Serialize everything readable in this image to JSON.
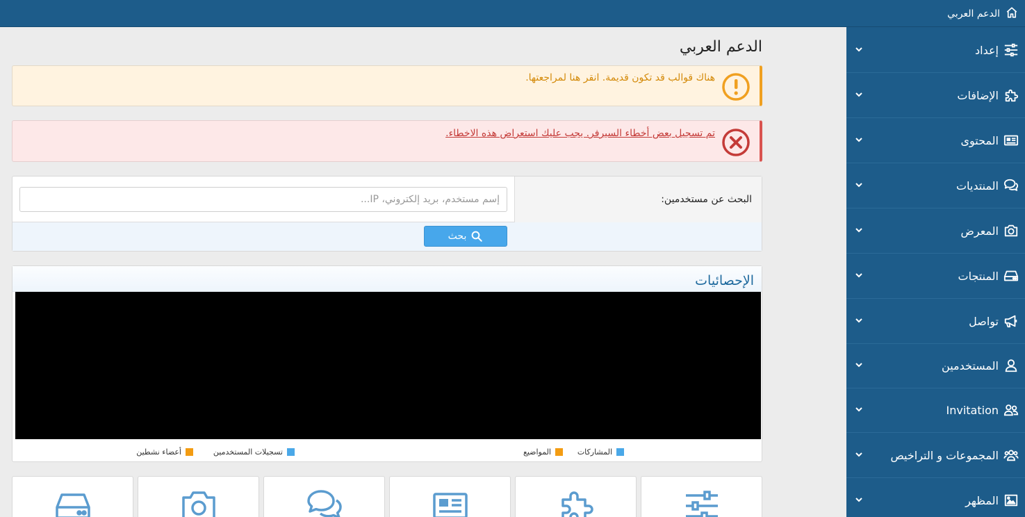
{
  "topbar": {
    "home_label": "الدعم العربي",
    "icon": "home-icon"
  },
  "sidebar": {
    "items": [
      {
        "label": "إعداد",
        "icon": "sliders-icon"
      },
      {
        "label": "الإضافات",
        "icon": "puzzle-icon"
      },
      {
        "label": "المحتوى",
        "icon": "newspaper-icon"
      },
      {
        "label": "المنتديات",
        "icon": "comments-icon"
      },
      {
        "label": "المعرض",
        "icon": "camera-icon"
      },
      {
        "label": "المنتجات",
        "icon": "hdd-icon"
      },
      {
        "label": "تواصل",
        "icon": "megaphone-icon"
      },
      {
        "label": "المستخدمين",
        "icon": "user-icon"
      },
      {
        "label": "Invitation",
        "icon": "user-friends-icon"
      },
      {
        "label": "المجموعات و التراخيص",
        "icon": "users-icon"
      },
      {
        "label": "المظهر",
        "icon": "image-icon"
      }
    ]
  },
  "main": {
    "title": "الدعم العربي",
    "warning": "هناك قوالب قد تكون قديمة. انقر هنا لمراجعتها.",
    "error": "تم تسجيل بعض أخطاء السيرفر. يجب عليك استعراض هذه الاخطاء.",
    "search": {
      "label": "البحث عن مستخدمين:",
      "placeholder": "إسم مستخدم، بريد إلكتروني، IP...",
      "button": "بحث"
    },
    "stats": {
      "title": "الإحصائيات",
      "legend": [
        {
          "label": "المشاركات",
          "color": "#4aa8e8"
        },
        {
          "label": "المواضيع",
          "color": "#f39c12"
        },
        {
          "label": "تسجيلات المستخدمين",
          "color": "#4aa8e8"
        },
        {
          "label": "أعضاء نشطين",
          "color": "#f39c12"
        }
      ]
    },
    "tiles": [
      "sliders-icon",
      "puzzle-icon",
      "newspaper-icon",
      "comments-icon",
      "camera-icon",
      "hdd-icon"
    ]
  }
}
